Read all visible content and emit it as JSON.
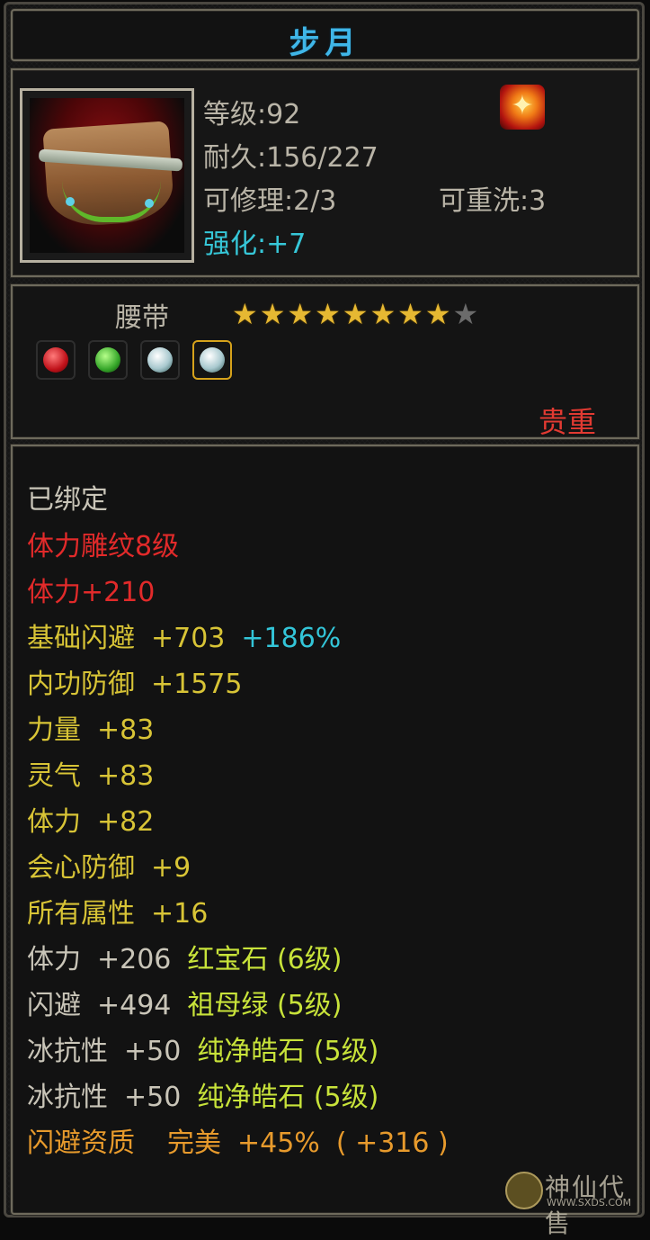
{
  "item": {
    "name": "步月",
    "level_label": "等级:",
    "level_value": "92",
    "durability_label": "耐久:",
    "durability_value": "156/227",
    "repair_label": "可修理:",
    "repair_value": "2/3",
    "rewash_label": "可重洗:",
    "rewash_value": "3",
    "enhance_label": "强化:",
    "enhance_value": "+7",
    "icon": "belt-icon",
    "rank_icon": "flame-rank-icon",
    "type": "腰带",
    "stars_total": 9,
    "stars_filled": 8,
    "rarity": "贵重"
  },
  "gems": [
    {
      "name": "ruby-gem-icon",
      "color": "red"
    },
    {
      "name": "emerald-gem-icon",
      "color": "green"
    },
    {
      "name": "clear-stone-gem-icon",
      "color": "white"
    },
    {
      "name": "clear-stone-gem-icon-selected",
      "color": "white"
    }
  ],
  "attributes": {
    "bound": "已绑定",
    "engrave": "体力雕纹8级",
    "engrave_bonus": "体力+210",
    "base_dodge_label": "基础闪避",
    "base_dodge_value": "+703",
    "base_dodge_pct": "+186%",
    "inner_def_label": "内功防御",
    "inner_def_value": "+1575",
    "strength_label": "力量",
    "strength_value": "+83",
    "spirit_label": "灵气",
    "spirit_value": "+83",
    "stamina_label": "体力",
    "stamina_value": "+82",
    "crit_def_label": "会心防御",
    "crit_def_value": "+9",
    "all_attr_label": "所有属性",
    "all_attr_value": "+16",
    "gem1_label": "体力",
    "gem1_value": "+206",
    "gem1_name": "红宝石 (6级)",
    "gem2_label": "闪避",
    "gem2_value": "+494",
    "gem2_name": "祖母绿 (5级)",
    "gem3_label": "冰抗性",
    "gem3_value": "+50",
    "gem3_name": "纯净皓石 (5级)",
    "gem4_label": "冰抗性",
    "gem4_value": "+50",
    "gem4_name": "纯净皓石 (5级)",
    "quality_label": "闪避资质",
    "quality_grade": "完美",
    "quality_pct": "+45%",
    "quality_bonus": "( +316 )"
  },
  "watermark": {
    "text": "神仙代售",
    "url": "WWW.SXDS.COM"
  },
  "colors": {
    "title": "#3fb6e8",
    "enhance": "#36c7d8",
    "rarity": "#e23a32",
    "engrave": "#e22a2a",
    "stat": "#d8c436",
    "gem_name": "#c8e33a",
    "quality": "#e79a2c",
    "star_on": "#e6b832",
    "star_off": "#6b6b6b"
  }
}
